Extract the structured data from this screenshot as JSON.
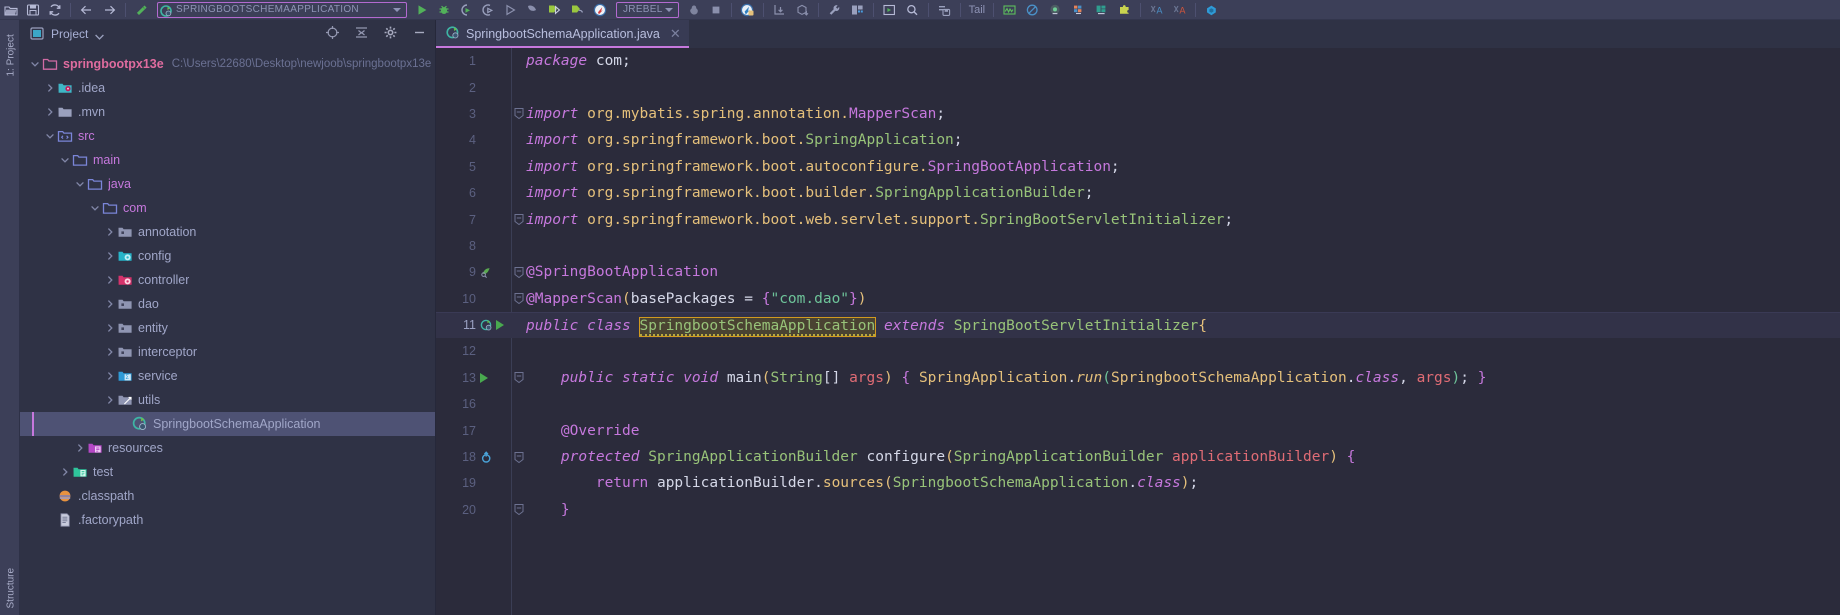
{
  "window": {
    "ide": "IntelliJ IDEA",
    "accent": "#c678dd",
    "bg": "#2b2b3b"
  },
  "toolbar": {
    "run_config": {
      "label": "SPRINGBOOTSCHEMAAPPLICATION",
      "icon": "spring-boot-run-config-icon",
      "dropdown": "▾",
      "highlighted": true
    },
    "jrebel": {
      "label": "JREBEL",
      "dropdown": "▾"
    },
    "tail_label": "Tail",
    "items": [
      {
        "name": "open-folder-icon",
        "glyph": "open"
      },
      {
        "name": "save-all-icon",
        "glyph": "save"
      },
      {
        "name": "sync-refresh-icon",
        "glyph": "sync"
      },
      {
        "name": "back-arrow-icon",
        "glyph": "back"
      },
      {
        "name": "forward-arrow-icon",
        "glyph": "forward"
      },
      {
        "name": "build-hammer-icon",
        "glyph": "hammer"
      },
      {
        "name": "run-button",
        "glyph": "run"
      },
      {
        "name": "debug-button",
        "glyph": "debug"
      },
      {
        "name": "run-with-coverage-icon",
        "glyph": "coverage"
      },
      {
        "name": "profile-icon",
        "glyph": "profile"
      },
      {
        "name": "run-gray-icon",
        "glyph": "run-gray"
      },
      {
        "name": "debug-gray-icon",
        "glyph": "debug-gray"
      },
      {
        "name": "rerun-green-icon",
        "glyph": "rerun"
      },
      {
        "name": "attach-process-icon",
        "glyph": "attach"
      },
      {
        "name": "jrebel-run-icon",
        "glyph": "jrebel-run"
      },
      {
        "name": "stop-icon",
        "glyph": "stop"
      },
      {
        "name": "update-app-icon",
        "glyph": "update"
      },
      {
        "name": "deploy-icon",
        "glyph": "deploy"
      },
      {
        "name": "download-icon",
        "glyph": "download"
      },
      {
        "name": "wrench-settings-icon",
        "glyph": "wrench"
      },
      {
        "name": "project-structure-icon",
        "glyph": "structure"
      },
      {
        "name": "run-anything-icon",
        "glyph": "run-anything"
      },
      {
        "name": "search-everywhere-icon",
        "glyph": "search"
      },
      {
        "name": "console-icon",
        "glyph": "console"
      },
      {
        "name": "tail-log-icon",
        "glyph": "tail"
      },
      {
        "name": "monitor-chart-icon",
        "glyph": "monitor"
      },
      {
        "name": "mute-breakpoints-icon",
        "glyph": "mute"
      },
      {
        "name": "database-icon",
        "glyph": "db"
      },
      {
        "name": "layout-grid-icon",
        "glyph": "grid"
      },
      {
        "name": "terminal-tool-icon",
        "glyph": "terminal"
      },
      {
        "name": "plugin-puzzle-icon",
        "glyph": "puzzle"
      },
      {
        "name": "translate-blue-icon",
        "glyph": "translate-a"
      },
      {
        "name": "translate-red-icon",
        "glyph": "translate-r"
      },
      {
        "name": "docker-icon",
        "glyph": "docker"
      }
    ]
  },
  "leftrail": {
    "top_label": "1: Project",
    "bottom_label": "Structure"
  },
  "project_panel": {
    "title": "Project",
    "dropdown": "▾",
    "header_icons": [
      {
        "name": "scroll-from-source-icon"
      },
      {
        "name": "collapse-all-icon"
      },
      {
        "name": "settings-gear-icon"
      },
      {
        "name": "hide-panel-icon"
      }
    ],
    "tree": [
      {
        "label": "springbootpx13e",
        "path": "C:\\Users\\22680\\Desktop\\newjoob\\springbootpx13e",
        "depth": 0,
        "twisty": "down",
        "icon": "module-folder-icon",
        "style": "root",
        "selected": false
      },
      {
        "label": ".idea",
        "path": "",
        "depth": 1,
        "twisty": "right",
        "icon": "idea-folder-icon",
        "style": "plain",
        "selected": false
      },
      {
        "label": ".mvn",
        "path": "",
        "depth": 1,
        "twisty": "right",
        "icon": "folder-icon",
        "style": "plain",
        "selected": false
      },
      {
        "label": "src",
        "path": "",
        "depth": 1,
        "twisty": "down",
        "icon": "source-root-icon",
        "style": "pkg",
        "selected": false
      },
      {
        "label": "main",
        "path": "",
        "depth": 2,
        "twisty": "down",
        "icon": "folder-open-icon",
        "style": "pkg",
        "selected": false
      },
      {
        "label": "java",
        "path": "",
        "depth": 3,
        "twisty": "down",
        "icon": "folder-open-icon",
        "style": "pkg",
        "selected": false
      },
      {
        "label": "com",
        "path": "",
        "depth": 4,
        "twisty": "down",
        "icon": "folder-open-icon",
        "style": "pkg",
        "selected": false
      },
      {
        "label": "annotation",
        "path": "",
        "depth": 5,
        "twisty": "right",
        "icon": "package-gray-icon",
        "style": "plain",
        "selected": false
      },
      {
        "label": "config",
        "path": "",
        "depth": 5,
        "twisty": "right",
        "icon": "package-config-icon",
        "style": "plain",
        "selected": false
      },
      {
        "label": "controller",
        "path": "",
        "depth": 5,
        "twisty": "right",
        "icon": "package-controller-icon",
        "style": "plain",
        "selected": false
      },
      {
        "label": "dao",
        "path": "",
        "depth": 5,
        "twisty": "right",
        "icon": "package-gray-icon",
        "style": "plain",
        "selected": false
      },
      {
        "label": "entity",
        "path": "",
        "depth": 5,
        "twisty": "right",
        "icon": "package-gray-icon",
        "style": "plain",
        "selected": false
      },
      {
        "label": "interceptor",
        "path": "",
        "depth": 5,
        "twisty": "right",
        "icon": "package-gray-icon",
        "style": "plain",
        "selected": false
      },
      {
        "label": "service",
        "path": "",
        "depth": 5,
        "twisty": "right",
        "icon": "package-service-icon",
        "style": "plain",
        "selected": false
      },
      {
        "label": "utils",
        "path": "",
        "depth": 5,
        "twisty": "right",
        "icon": "package-utils-icon",
        "style": "plain",
        "selected": false
      },
      {
        "label": "SpringbootSchemaApplication",
        "path": "",
        "depth": 6,
        "twisty": "none",
        "icon": "spring-boot-class-icon",
        "style": "plain",
        "selected": true
      },
      {
        "label": "resources",
        "path": "",
        "depth": 3,
        "twisty": "right",
        "icon": "resources-folder-icon",
        "style": "plain",
        "selected": false
      },
      {
        "label": "test",
        "path": "",
        "depth": 2,
        "twisty": "right",
        "icon": "test-folder-icon",
        "style": "plain",
        "selected": false
      },
      {
        "label": ".classpath",
        "path": "",
        "depth": 1,
        "twisty": "none",
        "icon": "classpath-file-icon",
        "style": "plain",
        "selected": false
      },
      {
        "label": ".factorypath",
        "path": "",
        "depth": 1,
        "twisty": "none",
        "icon": "xml-file-icon",
        "style": "plain",
        "selected": false
      }
    ]
  },
  "editor": {
    "tab": {
      "label": "SpringbootSchemaApplication.java",
      "icon": "spring-boot-class-icon",
      "close": "✕",
      "active": true
    },
    "lines": [
      {
        "no": "1",
        "gutter": "",
        "fold": "",
        "current": false,
        "tokens": [
          {
            "t": "package",
            "c": "kw"
          },
          {
            "t": " ",
            "c": "txt"
          },
          {
            "t": "com",
            "c": "txt"
          },
          {
            "t": ";",
            "c": "punc"
          }
        ]
      },
      {
        "no": "2",
        "gutter": "",
        "fold": "",
        "current": false,
        "tokens": []
      },
      {
        "no": "3",
        "gutter": "",
        "fold": "-",
        "current": false,
        "tokens": [
          {
            "t": "import",
            "c": "kw"
          },
          {
            "t": " ",
            "c": "txt"
          },
          {
            "t": "org.mybatis.spring.annotation.",
            "c": "pkgc"
          },
          {
            "t": "MapperScan",
            "c": "ann"
          },
          {
            "t": ";",
            "c": "punc"
          }
        ]
      },
      {
        "no": "4",
        "gutter": "",
        "fold": "",
        "current": false,
        "tokens": [
          {
            "t": "import",
            "c": "kw"
          },
          {
            "t": " ",
            "c": "txt"
          },
          {
            "t": "org.springframework.boot.",
            "c": "pkgc"
          },
          {
            "t": "SpringApplication",
            "c": "cls"
          },
          {
            "t": ";",
            "c": "punc"
          }
        ]
      },
      {
        "no": "5",
        "gutter": "",
        "fold": "",
        "current": false,
        "tokens": [
          {
            "t": "import",
            "c": "kw"
          },
          {
            "t": " ",
            "c": "txt"
          },
          {
            "t": "org.springframework.boot.autoconfigure.",
            "c": "pkgc"
          },
          {
            "t": "SpringBootApplication",
            "c": "ann"
          },
          {
            "t": ";",
            "c": "punc"
          }
        ]
      },
      {
        "no": "6",
        "gutter": "",
        "fold": "",
        "current": false,
        "tokens": [
          {
            "t": "import",
            "c": "kw"
          },
          {
            "t": " ",
            "c": "txt"
          },
          {
            "t": "org.springframework.boot.builder.",
            "c": "pkgc"
          },
          {
            "t": "SpringApplicationBuilder",
            "c": "cls"
          },
          {
            "t": ";",
            "c": "punc"
          }
        ]
      },
      {
        "no": "7",
        "gutter": "",
        "fold": "-",
        "current": false,
        "tokens": [
          {
            "t": "import",
            "c": "kw"
          },
          {
            "t": " ",
            "c": "txt"
          },
          {
            "t": "org.springframework.boot.web.servlet.support.",
            "c": "pkgc"
          },
          {
            "t": "SpringBootServletInitializer",
            "c": "cls"
          },
          {
            "t": ";",
            "c": "punc"
          }
        ]
      },
      {
        "no": "8",
        "gutter": "",
        "fold": "",
        "current": false,
        "tokens": []
      },
      {
        "no": "9",
        "gutter": "spring-bean-icon",
        "fold": "-",
        "current": false,
        "tokens": [
          {
            "t": "@SpringBootApplication",
            "c": "ann"
          }
        ]
      },
      {
        "no": "10",
        "gutter": "",
        "fold": "-",
        "current": false,
        "tokens": [
          {
            "t": "@MapperScan",
            "c": "ann"
          },
          {
            "t": "(",
            "c": "brc1"
          },
          {
            "t": "basePackages",
            "c": "ident"
          },
          {
            "t": " = ",
            "c": "punc"
          },
          {
            "t": "{",
            "c": "brc2"
          },
          {
            "t": "\"com.dao\"",
            "c": "str"
          },
          {
            "t": "}",
            "c": "brc2"
          },
          {
            "t": ")",
            "c": "brc1"
          }
        ]
      },
      {
        "no": "11",
        "gutter": "spring-run-icon",
        "fold": "",
        "current": true,
        "tokens": [
          {
            "t": "public",
            "c": "kw"
          },
          {
            "t": " ",
            "c": "txt"
          },
          {
            "t": "class",
            "c": "kw"
          },
          {
            "t": " ",
            "c": "txt"
          },
          {
            "t": "SpringbootSchemaApplication",
            "c": "hl-name"
          },
          {
            "t": " ",
            "c": "txt"
          },
          {
            "t": "extends",
            "c": "kw"
          },
          {
            "t": " ",
            "c": "txt"
          },
          {
            "t": "SpringBootServletInitializer",
            "c": "cls"
          },
          {
            "t": "{",
            "c": "brc1"
          }
        ]
      },
      {
        "no": "12",
        "gutter": "",
        "fold": "",
        "current": false,
        "tokens": []
      },
      {
        "no": "13",
        "gutter": "run-method-icon",
        "fold": "-",
        "current": false,
        "tokens": [
          {
            "t": "    ",
            "c": "txt"
          },
          {
            "t": "public",
            "c": "kw"
          },
          {
            "t": " ",
            "c": "txt"
          },
          {
            "t": "static",
            "c": "kw"
          },
          {
            "t": " ",
            "c": "txt"
          },
          {
            "t": "void",
            "c": "kw"
          },
          {
            "t": " ",
            "c": "txt"
          },
          {
            "t": "main",
            "c": "ident"
          },
          {
            "t": "(",
            "c": "brc1"
          },
          {
            "t": "String",
            "c": "cls"
          },
          {
            "t": "[] ",
            "c": "punc"
          },
          {
            "t": "args",
            "c": "prm"
          },
          {
            "t": ")",
            "c": "brc1"
          },
          {
            "t": " ",
            "c": "txt"
          },
          {
            "t": "{",
            "c": "brc2"
          },
          {
            "t": " ",
            "c": "txt"
          },
          {
            "t": "SpringApplication",
            "c": "mth"
          },
          {
            "t": ".",
            "c": "punc"
          },
          {
            "t": "run",
            "c": "mthi"
          },
          {
            "t": "(",
            "c": "brc3"
          },
          {
            "t": "SpringbootSchemaApplication",
            "c": "mth"
          },
          {
            "t": ".",
            "c": "punc"
          },
          {
            "t": "class",
            "c": "kw"
          },
          {
            "t": ", ",
            "c": "punc"
          },
          {
            "t": "args",
            "c": "prm"
          },
          {
            "t": ")",
            "c": "brc3"
          },
          {
            "t": "; ",
            "c": "punc"
          },
          {
            "t": "}",
            "c": "brc2"
          }
        ]
      },
      {
        "no": "16",
        "gutter": "",
        "fold": "",
        "current": false,
        "tokens": []
      },
      {
        "no": "17",
        "gutter": "",
        "fold": "",
        "current": false,
        "tokens": [
          {
            "t": "    ",
            "c": "txt"
          },
          {
            "t": "@Override",
            "c": "ann"
          }
        ]
      },
      {
        "no": "18",
        "gutter": "override-method-icon",
        "fold": "-",
        "current": false,
        "tokens": [
          {
            "t": "    ",
            "c": "txt"
          },
          {
            "t": "protected",
            "c": "kw"
          },
          {
            "t": " ",
            "c": "txt"
          },
          {
            "t": "SpringApplicationBuilder",
            "c": "cls"
          },
          {
            "t": " ",
            "c": "txt"
          },
          {
            "t": "configure",
            "c": "ident"
          },
          {
            "t": "(",
            "c": "brc1"
          },
          {
            "t": "SpringApplicationBuilder",
            "c": "cls"
          },
          {
            "t": " ",
            "c": "txt"
          },
          {
            "t": "applicationBuilder",
            "c": "prm"
          },
          {
            "t": ")",
            "c": "brc1"
          },
          {
            "t": " ",
            "c": "txt"
          },
          {
            "t": "{",
            "c": "brc2"
          }
        ]
      },
      {
        "no": "19",
        "gutter": "",
        "fold": "",
        "current": false,
        "tokens": [
          {
            "t": "        ",
            "c": "txt"
          },
          {
            "t": "return",
            "c": "kw2"
          },
          {
            "t": " ",
            "c": "txt"
          },
          {
            "t": "applicationBuilder",
            "c": "ident"
          },
          {
            "t": ".",
            "c": "punc"
          },
          {
            "t": "sources",
            "c": "mth"
          },
          {
            "t": "(",
            "c": "brc1"
          },
          {
            "t": "SpringbootSchemaApplication",
            "c": "cls"
          },
          {
            "t": ".",
            "c": "punc"
          },
          {
            "t": "class",
            "c": "kw"
          },
          {
            "t": ")",
            "c": "brc1"
          },
          {
            "t": ";",
            "c": "punc"
          }
        ]
      },
      {
        "no": "20",
        "gutter": "",
        "fold": "-",
        "current": false,
        "tokens": [
          {
            "t": "    ",
            "c": "txt"
          },
          {
            "t": "}",
            "c": "brc2"
          }
        ]
      }
    ]
  }
}
